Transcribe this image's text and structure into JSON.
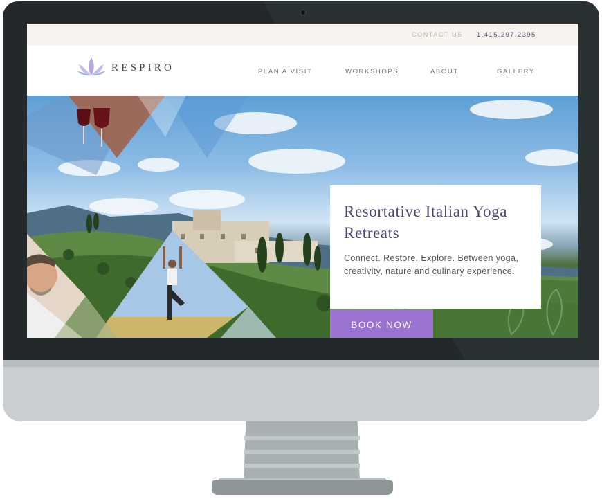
{
  "topbar": {
    "contact_label": "CONTACT US",
    "phone": "1.415.297.2395"
  },
  "brand": {
    "name": "RESPIRO"
  },
  "nav": {
    "items": [
      "PLAN A VISIT",
      "WORKSHOPS",
      "ABOUT",
      "GALLERY"
    ]
  },
  "hero": {
    "title": "Resortative Italian Yoga Retreats",
    "subtitle": "Connect. Restore. Explore. Between yoga, creativity, nature and culinary experience.",
    "cta_label": "BOOK NOW"
  },
  "colors": {
    "accent_purple": "#9a72d0",
    "title_purple": "#4d4678",
    "topbar_bg": "#f7f4ef",
    "bezel": "#23292b",
    "stand": "#c9cfd0"
  },
  "icons": [
    "lotus-logo-icon",
    "wine-glasses-photo",
    "yoga-pose-photo",
    "smiling-man-photo",
    "tuscany-villa-photo"
  ]
}
